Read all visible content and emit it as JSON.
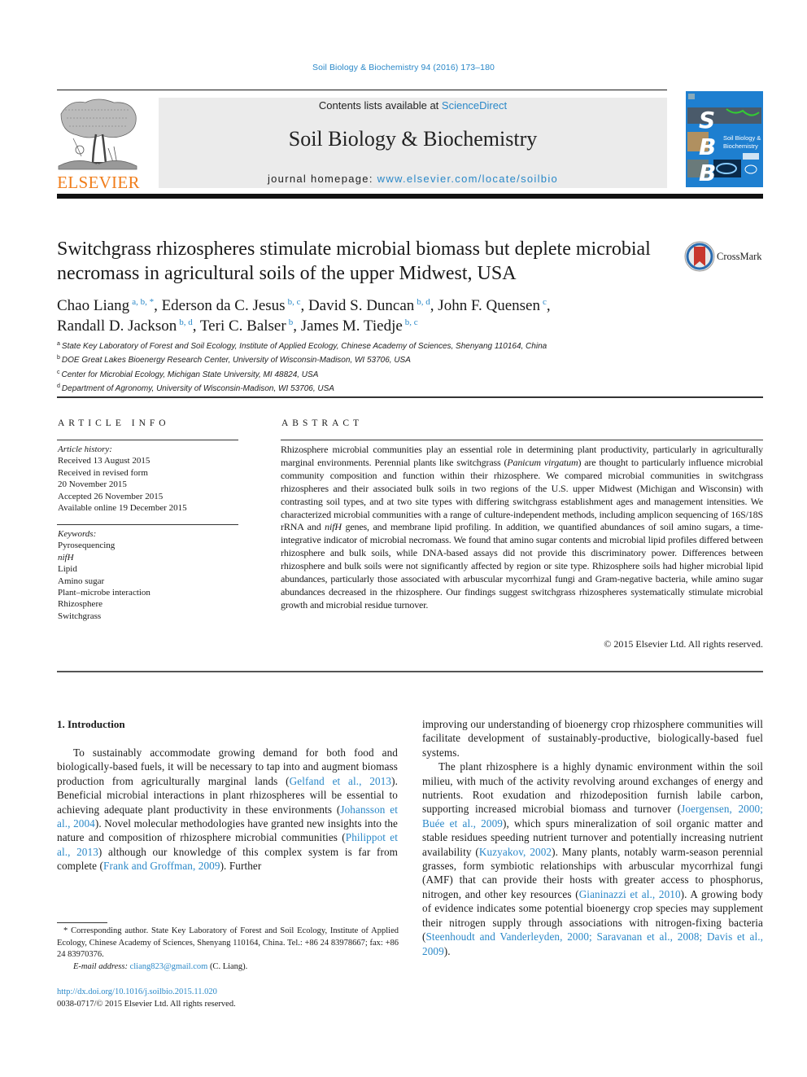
{
  "running_head": "Soil Biology & Biochemistry 94 (2016) 173–180",
  "masthead": {
    "publisher_name": "ELSEVIER",
    "contents_prefix": "Contents lists available at ",
    "contents_link": "ScienceDirect",
    "journal_title": "Soil Biology & Biochemistry",
    "homepage_prefix": "journal homepage: ",
    "homepage_link": "www.elsevier.com/locate/soilbio",
    "cover": {
      "letters": [
        "S",
        "B",
        "B"
      ],
      "title_line1": "Soil Biology &",
      "title_line2": "Biochemistry",
      "background_color": "#1e7fd0"
    }
  },
  "article": {
    "title": "Switchgrass rhizospheres stimulate microbial biomass but deplete microbial necromass in agricultural soils of the upper Midwest, USA",
    "crossmark_label": "CrossMark",
    "authors": [
      {
        "name": "Chao Liang",
        "sup": "a, b, *",
        "sep": ", "
      },
      {
        "name": "Ederson da C. Jesus",
        "sup": "b, c",
        "sep": ", "
      },
      {
        "name": "David S. Duncan",
        "sup": "b, d",
        "sep": ", "
      },
      {
        "name": "John F. Quensen",
        "sup": "c",
        "sep": ","
      },
      {
        "name": "Randall D. Jackson",
        "sup": "b, d",
        "sep": ", "
      },
      {
        "name": "Teri C. Balser",
        "sup": "b",
        "sep": ", "
      },
      {
        "name": "James M. Tiedje",
        "sup": "b, c",
        "sep": ""
      }
    ],
    "affiliations": [
      {
        "key": "a",
        "text": "State Key Laboratory of Forest and Soil Ecology, Institute of Applied Ecology, Chinese Academy of Sciences, Shenyang 110164, China"
      },
      {
        "key": "b",
        "text": "DOE Great Lakes Bioenergy Research Center, University of Wisconsin-Madison, WI 53706, USA"
      },
      {
        "key": "c",
        "text": "Center for Microbial Ecology, Michigan State University, MI 48824, USA"
      },
      {
        "key": "d",
        "text": "Department of Agronomy, University of Wisconsin-Madison, WI 53706, USA"
      }
    ]
  },
  "article_info": {
    "heading": "ARTICLE INFO",
    "history_label": "Article history:",
    "history": [
      "Received 13 August 2015",
      "Received in revised form",
      "20 November 2015",
      "Accepted 26 November 2015",
      "Available online 19 December 2015"
    ],
    "keywords_label": "Keywords:",
    "keywords": [
      {
        "text": "Pyrosequencing",
        "italic": false
      },
      {
        "text": "nifH",
        "italic": true
      },
      {
        "text": "Lipid",
        "italic": false
      },
      {
        "text": "Amino sugar",
        "italic": false
      },
      {
        "text": "Plant–microbe interaction",
        "italic": false
      },
      {
        "text": "Rhizosphere",
        "italic": false
      },
      {
        "text": "Switchgrass",
        "italic": false
      }
    ]
  },
  "abstract": {
    "heading": "ABSTRACT",
    "segments": [
      {
        "text": "Rhizosphere microbial communities play an essential role in determining plant productivity, particularly in agriculturally marginal environments. Perennial plants like switchgrass (",
        "italic": false
      },
      {
        "text": "Panicum virgatum",
        "italic": true
      },
      {
        "text": ") are thought to particularly influence microbial community composition and function within their rhizosphere. We compared microbial communities in switchgrass rhizospheres and their associated bulk soils in two regions of the U.S. upper Midwest (Michigan and Wisconsin) with contrasting soil types, and at two site types with differing switchgrass establishment ages and management intensities. We characterized microbial communities with a range of culture-independent methods, including amplicon sequencing of 16S/18S rRNA and ",
        "italic": false
      },
      {
        "text": "nifH",
        "italic": true
      },
      {
        "text": " genes, and membrane lipid profiling. In addition, we quantified abundances of soil amino sugars, a time-integrative indicator of microbial necromass. We found that amino sugar contents and microbial lipid profiles differed between rhizosphere and bulk soils, while DNA-based assays did not provide this discriminatory power. Differences between rhizosphere and bulk soils were not significantly affected by region or site type. Rhizosphere soils had higher microbial lipid abundances, particularly those associated with arbuscular mycorrhizal fungi and Gram-negative bacteria, while amino sugar abundances decreased in the rhizosphere. Our findings suggest switchgrass rhizospheres systematically stimulate microbial growth and microbial residue turnover.",
        "italic": false
      }
    ],
    "copyright": "© 2015 Elsevier Ltd. All rights reserved."
  },
  "body": {
    "section_heading": "1.  Introduction",
    "left_paragraphs": [
      [
        {
          "text": "To sustainably accommodate growing demand for both food and biologically-based fuels, it will be necessary to tap into and augment biomass production from agriculturally marginal lands (",
          "link": false
        },
        {
          "text": "Gelfand et al., 2013",
          "link": true
        },
        {
          "text": "). Beneficial microbial interactions in plant rhizospheres will be essential to achieving adequate plant productivity in these environments (",
          "link": false
        },
        {
          "text": "Johansson et al., 2004",
          "link": true
        },
        {
          "text": "). Novel molecular methodologies have granted new insights into the nature and composition of rhizosphere microbial communities (",
          "link": false
        },
        {
          "text": "Philippot et al., 2013",
          "link": true
        },
        {
          "text": ") although our knowledge of this complex system is far from complete (",
          "link": false
        },
        {
          "text": "Frank and Groffman, 2009",
          "link": true
        },
        {
          "text": "). Further",
          "link": false
        }
      ]
    ],
    "right_paragraphs": [
      [
        {
          "text": "improving our understanding of bioenergy crop rhizosphere communities will facilitate development of sustainably-productive, biologically-based fuel systems.",
          "link": false
        }
      ],
      [
        {
          "text": "The plant rhizosphere is a highly dynamic environment within the soil milieu, with much of the activity revolving around exchanges of energy and nutrients. Root exudation and rhizodeposition furnish labile carbon, supporting increased microbial biomass and turnover (",
          "link": false
        },
        {
          "text": "Joergensen, 2000; Buée et al., 2009",
          "link": true
        },
        {
          "text": "), which spurs mineralization of soil organic matter and stable residues speeding nutrient turnover and potentially increasing nutrient availability (",
          "link": false
        },
        {
          "text": "Kuzyakov, 2002",
          "link": true
        },
        {
          "text": "). Many plants, notably warm-season perennial grasses, form symbiotic relationships with arbuscular mycorrhizal fungi (AMF) that can provide their hosts with greater access to phosphorus, nitrogen, and other key resources (",
          "link": false
        },
        {
          "text": "Gianinazzi et al., 2010",
          "link": true
        },
        {
          "text": "). A growing body of evidence indicates some potential bioenergy crop species may supplement their nitrogen supply through associations with nitrogen-fixing bacteria (",
          "link": false
        },
        {
          "text": "Steenhoudt and Vanderleyden, 2000; Saravanan et al., 2008; Davis et al., 2009",
          "link": true
        },
        {
          "text": ").",
          "link": false
        }
      ]
    ]
  },
  "footnote": {
    "corresponding": "* Corresponding author. State Key Laboratory of Forest and Soil Ecology, Institute of Applied Ecology, Chinese Academy of Sciences, Shenyang 110164, China. Tel.: +86 24 83978667; fax: +86 24 83970376.",
    "email_label": "E-mail address: ",
    "email": "cliang823@gmail.com",
    "email_suffix": " (C. Liang)."
  },
  "doi": {
    "link": "http://dx.doi.org/10.1016/j.soilbio.2015.11.020",
    "issn_line": "0038-0717/© 2015 Elsevier Ltd. All rights reserved."
  },
  "colors": {
    "link": "#2a88c8",
    "elsevier_orange": "#f07d1a",
    "masthead_gray": "#ebebeb",
    "crossmark_red": "#c8372d"
  }
}
